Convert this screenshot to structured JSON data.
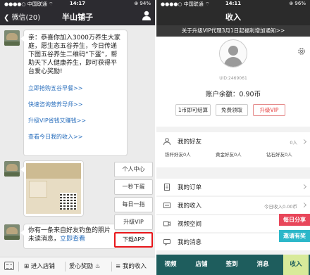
{
  "left": {
    "status": {
      "carrier": "●●●●○ 中国联通 ⌔",
      "time": "14:17",
      "battery": "⊕ 94%"
    },
    "nav": {
      "back_label": "微信(20)",
      "title": "半山铺子"
    },
    "message1": {
      "text": "亲：恭喜你加入3000万养生大家庭，愿生态五谷养生，今日传递下图五谷养生二维码“下蛋”，帮助天下人健康养生，即可获得平台爱心奖励!",
      "links": [
        "立即抢购五谷早餐>>",
        "快速咨询营养导师>>",
        "升级VIP省钱又赚钱>>",
        "查看今日我的收入>>"
      ]
    },
    "message3": {
      "text": "你有一条来自好友钓鱼的照片未读消息，",
      "link": "立即查看"
    },
    "popup_menu": [
      "个人中心",
      "一秒下蛋",
      "每日一指",
      "升级VIP",
      "下载APP"
    ],
    "bottom_bar": {
      "item1": "进入店铺",
      "item2": "爱心奖励",
      "item3": "我的收入",
      "menu_icon": "≡",
      "icon1": "⊞",
      "icon2": "♨"
    }
  },
  "right": {
    "status": {
      "carrier": "●●●●○ 中国联通 ⌔",
      "time": "14:11",
      "battery": "⊕ 96%"
    },
    "title": "收入",
    "notice": "关于升级VIP代理3月1日起福利增加通知>>",
    "user_id": "UID:2469061",
    "balance": "账户余额：0.90币",
    "buttons": [
      "1币即可结算",
      "免费领取",
      "升级VIP"
    ],
    "friends": {
      "label": "我的好友",
      "count": "0人",
      "sub": [
        "铁杆好友0人",
        "黄金好友0人",
        "钻石好友0人"
      ]
    },
    "rows": [
      {
        "label": "我的订单",
        "value": "",
        "icon": "document-icon"
      },
      {
        "label": "我的收入",
        "value": "今日收入0.00币",
        "icon": "income-icon"
      },
      {
        "label": "视频空间",
        "value": "",
        "icon": "video-icon"
      },
      {
        "label": "我的消息",
        "value": "",
        "icon": "message-icon"
      }
    ],
    "fabs": [
      {
        "label": "每日分享",
        "color": "#e8465a"
      },
      {
        "label": "邀请有奖",
        "color": "#2bb7c9"
      }
    ],
    "tabs": [
      "视频",
      "店铺",
      "签到",
      "消息",
      "收入"
    ],
    "active_tab": "收入",
    "colors": {
      "tabbar": "#1e5d5d",
      "active_tab": "#d8ea9a",
      "vip_red": "#e53a3a"
    }
  }
}
